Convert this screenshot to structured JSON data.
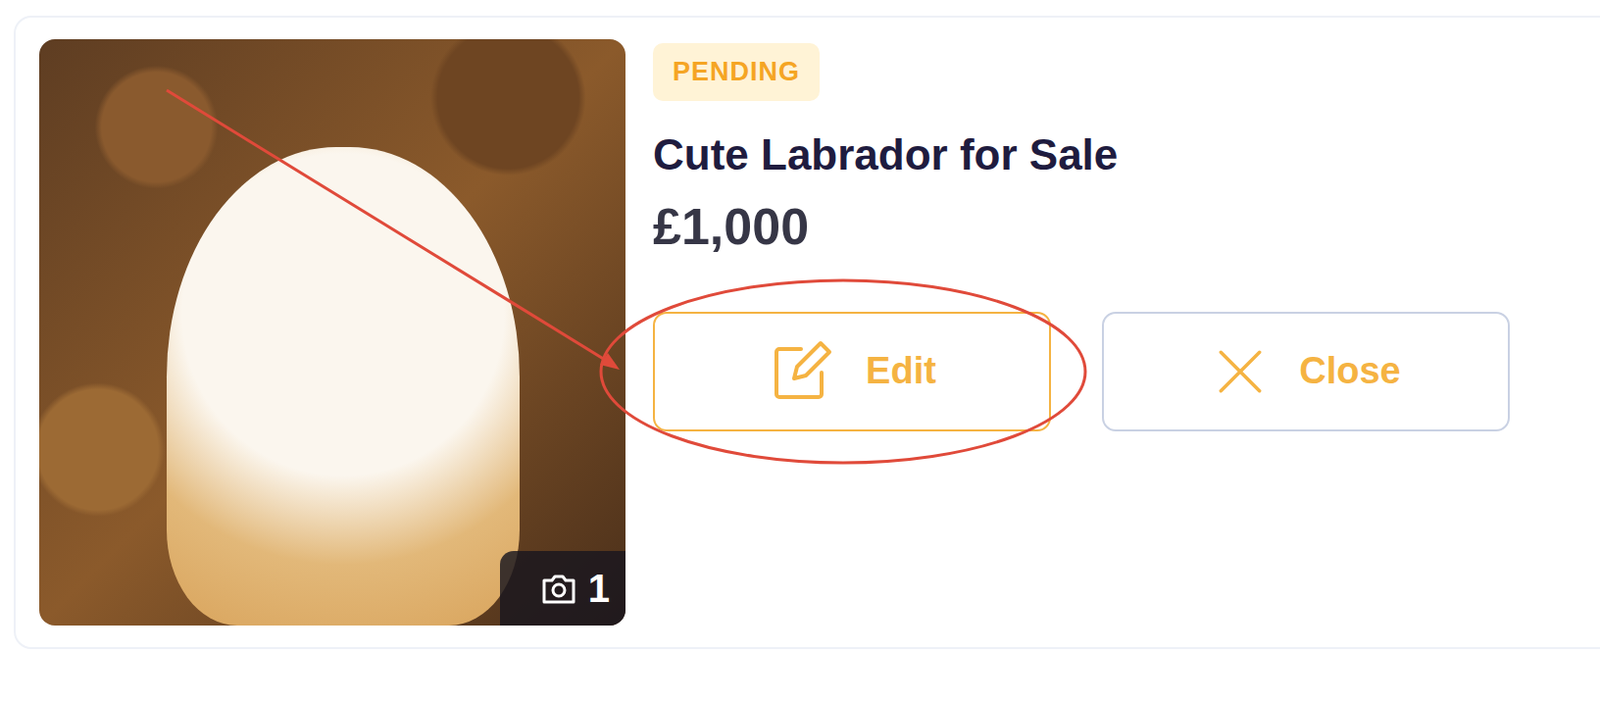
{
  "listing": {
    "status": "PENDING",
    "title": "Cute Labrador for Sale",
    "price": "£1,000",
    "photo_count": "1"
  },
  "buttons": [
    {
      "label": "Edit",
      "kind": "edit",
      "highlighted": true
    },
    {
      "label": "Close",
      "kind": "close",
      "highlighted": false
    }
  ]
}
